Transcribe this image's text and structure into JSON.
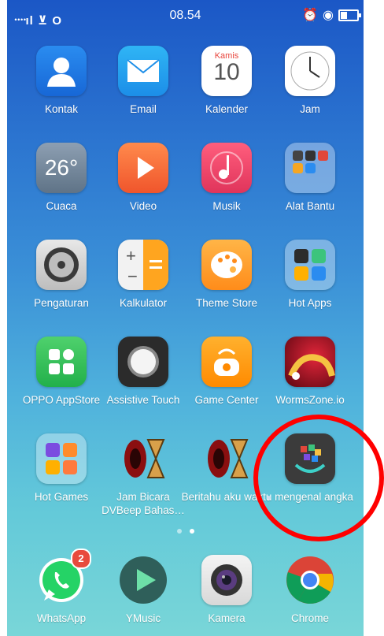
{
  "status_bar": {
    "left_icons": "̶1̀✓ O",
    "time": "08.54"
  },
  "apps": [
    {
      "label": "Kontak"
    },
    {
      "label": "Email"
    },
    {
      "label": "Kalender",
      "day_name": "Kamis",
      "day_num": "10"
    },
    {
      "label": "Jam"
    },
    {
      "label": "Cuaca",
      "temp": "26°"
    },
    {
      "label": "Video"
    },
    {
      "label": "Musik"
    },
    {
      "label": "Alat Bantu"
    },
    {
      "label": "Pengaturan"
    },
    {
      "label": "Kalkulator"
    },
    {
      "label": "Theme Store"
    },
    {
      "label": "Hot Apps"
    },
    {
      "label": "OPPO AppStore"
    },
    {
      "label": "Assistive Touch"
    },
    {
      "label": "Game Center"
    },
    {
      "label": "WormsZone.io"
    },
    {
      "label": "Hot Games"
    },
    {
      "label": "Jam Bicara DVBeep Bahas…"
    },
    {
      "label": "Beritahu aku waktu"
    },
    {
      "label": "mengenal angka"
    }
  ],
  "dock": [
    {
      "label": "WhatsApp",
      "badge": "2"
    },
    {
      "label": "YMusic"
    },
    {
      "label": "Kamera"
    },
    {
      "label": "Chrome"
    }
  ],
  "colors": {
    "highlight": "#ff0000",
    "badge": "#e84a3d"
  }
}
